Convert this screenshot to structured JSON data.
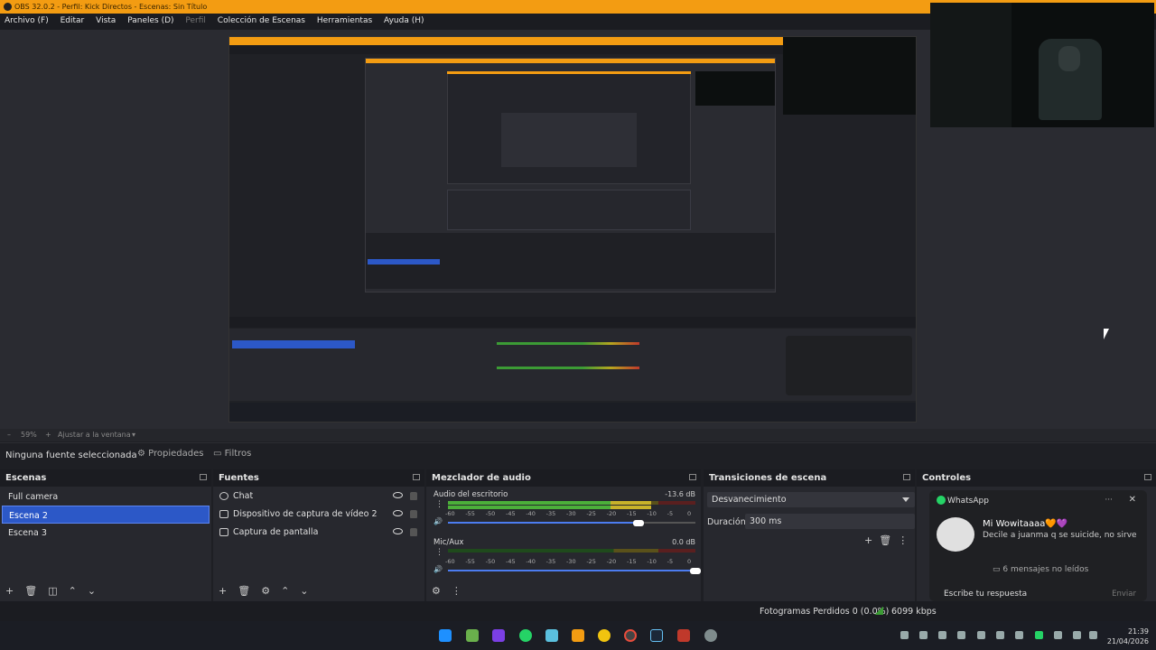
{
  "window": {
    "title": "OBS 32.0.2 - Perfil: Kick Directos - Escenas: Sin Título"
  },
  "menu": [
    "Archivo (F)",
    "Editar",
    "Vista",
    "Paneles (D)",
    "Perfil",
    "Colección de Escenas",
    "Herramientas",
    "Ayuda (H)"
  ],
  "zoom": {
    "value": "59%",
    "fit_label": "Ajustar a la ventana"
  },
  "source_toolbar": {
    "selection": "Ninguna fuente seleccionada",
    "properties": "Propiedades",
    "filters": "Filtros"
  },
  "scenes": {
    "title": "Escenas",
    "items": [
      {
        "label": "Full camera"
      },
      {
        "label": "Escena 2",
        "selected": true
      },
      {
        "label": "Escena 3"
      }
    ]
  },
  "sources": {
    "title": "Fuentes",
    "items": [
      {
        "label": "Chat",
        "icon": "globe-icon"
      },
      {
        "label": "Dispositivo de captura de vídeo 2",
        "icon": "camera-icon"
      },
      {
        "label": "Captura de pantalla",
        "icon": "monitor-icon"
      }
    ]
  },
  "mixer": {
    "title": "Mezclador de audio",
    "scale": [
      "-60",
      "-55",
      "-50",
      "-45",
      "-40",
      "-35",
      "-30",
      "-25",
      "-20",
      "-15",
      "-10",
      "-5",
      "0"
    ],
    "channels": [
      {
        "name": "Audio del escritorio",
        "db": "-13.6 dB",
        "level": 0.82,
        "volume": 0.77
      },
      {
        "name": "Mic/Aux",
        "db": "0.0 dB",
        "level": 0.0,
        "volume": 1.0
      }
    ]
  },
  "transitions": {
    "title": "Transiciones de escena",
    "selected": "Desvanecimiento",
    "duration_label": "Duración",
    "duration_value": "300 ms"
  },
  "controls": {
    "title": "Controles"
  },
  "whatsapp": {
    "app": "WhatsApp",
    "sender": "Mi Wowitaaaa🧡💜",
    "message": "Decile a juanma q se suicide, no sirve",
    "unread": "6 mensajes no leídos",
    "reply_placeholder": "Escribe tu respuesta",
    "send": "Enviar"
  },
  "status": {
    "dropped": "Fotogramas Perdidos 0 (0.0%)",
    "bitrate": "6099 kbps"
  },
  "clock": {
    "time": "21:39",
    "date": "21/04/2026"
  },
  "colors": {
    "accent": "#f39c12",
    "selection": "#2c58c7",
    "whatsapp": "#25d366"
  }
}
